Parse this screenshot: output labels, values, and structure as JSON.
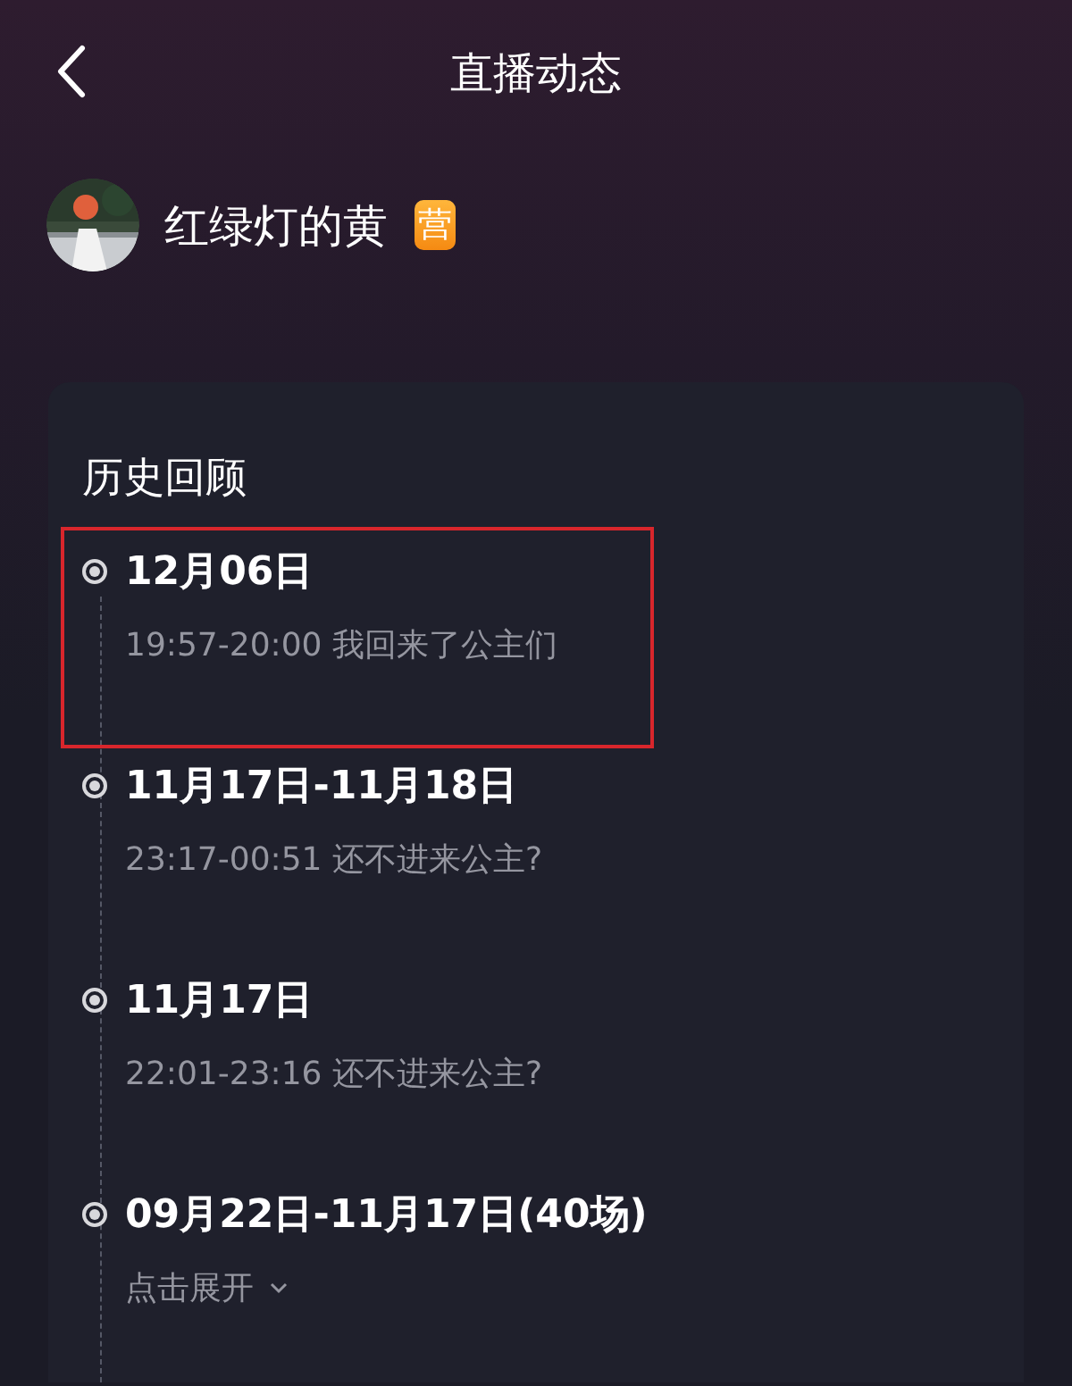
{
  "header": {
    "title": "直播动态"
  },
  "streamer": {
    "name": "红绿灯的黄",
    "badge": "营"
  },
  "history": {
    "title": "历史回顾",
    "entries": [
      {
        "kind": "session",
        "date": "12月06日",
        "detail": "19:57-20:00 我回来了公主们",
        "highlighted": true
      },
      {
        "kind": "session",
        "date": "11月17日-11月18日",
        "detail": "23:17-00:51 还不进来公主?",
        "highlighted": false
      },
      {
        "kind": "session",
        "date": "11月17日",
        "detail": "22:01-23:16 还不进来公主?",
        "highlighted": false
      },
      {
        "kind": "group",
        "date": "09月22日-11月17日(40场)",
        "detail": "点击展开",
        "highlighted": false
      }
    ]
  }
}
